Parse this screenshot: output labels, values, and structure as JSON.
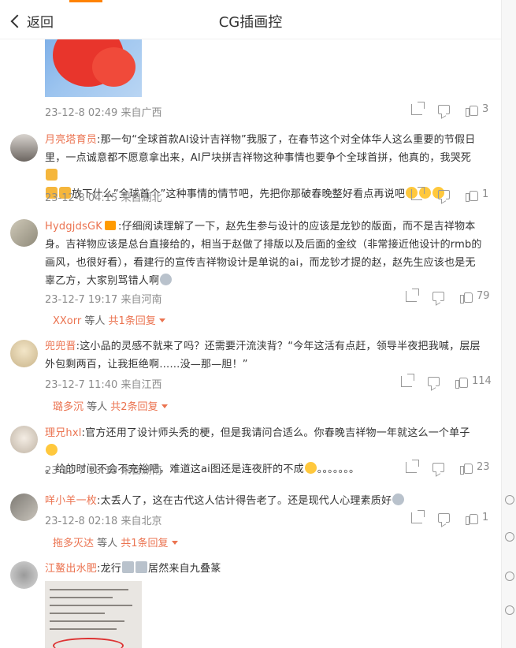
{
  "topbar": {
    "back_label": "返回",
    "title": "CG插画控"
  },
  "top_item": {
    "meta": "23-12-8 02:49 来自广西",
    "like_count": "3"
  },
  "comments": [
    {
      "user": "月亮塔育员",
      "text": ":那一句“全球首款AI设计吉祥物”我服了，在春节这个对全体华人这么重要的节假日里，一点诚意都不愿意拿出来，AI尸块拼吉祥物这种事情也要争个全球首拼，他真的，我哭死",
      "text2": "放下什么”全球首个”这种事情的情节吧，先把你那破春晚整好看点再说吧",
      "meta": "23-12-8 04:15 来自湖北",
      "like_count": "1"
    },
    {
      "user": "HydgjdsGK",
      "text": ":仔细阅读理解了一下，赵先生参与设计的应该是龙钞的版面，而不是吉祥物本身。吉祥物应该是总台直接给的，相当于赵做了排版以及后面的金纹（非常接近他设计的rmb的画风，也很好看），看建行的宣传吉祥物设计是单说的ai，而龙钞才提的赵，赵先生应该也是无辜乙方，大家别骂错人啊",
      "meta": "23-12-7 19:17 来自河南",
      "like_count": "79",
      "reply_user": "XXorr",
      "reply_mid": " 等人 ",
      "reply_count": "共1条回复"
    },
    {
      "user": "兜兜晋",
      "text": ":这小品的灵感不就来了吗？还需要汗流浃背？“今年这活有点赶，领导半夜把我喊，层层外包剩两百，让我拒绝啊……没—那—胆！”",
      "meta": "23-12-7 11:40 来自江西",
      "like_count": "114",
      "reply_user": "璐多沉",
      "reply_mid": " 等人 ",
      "reply_count": "共2条回复"
    },
    {
      "user": "理兄hxl",
      "text": ":官方还用了设计师头秃的梗，但是我请问合适么。你春晚吉祥物一年就这么一个单子",
      "text2": "。给的时间不会不充裕吧，难道这ai图还是连夜肝的不成",
      "text3": "。。。。。。。",
      "meta": "23-12-7 10:13 来自湖南",
      "like_count": "23"
    },
    {
      "user": "咩小羊一枚",
      "text": ":太丢人了，这在古代这人估计得告老了。还是现代人心理素质好",
      "meta": "23-12-8 02:18 来自北京",
      "like_count": "1",
      "reply_user": "拖多灭达",
      "reply_mid": " 等人 ",
      "reply_count": "共1条回复"
    },
    {
      "user": "江鳌出水肥",
      "text": ":龙行",
      "text2": "居然来自九叠篆"
    }
  ],
  "colors": {
    "accent": "#ff8200",
    "username": "#eb7350",
    "meta": "#8c8c8c"
  }
}
